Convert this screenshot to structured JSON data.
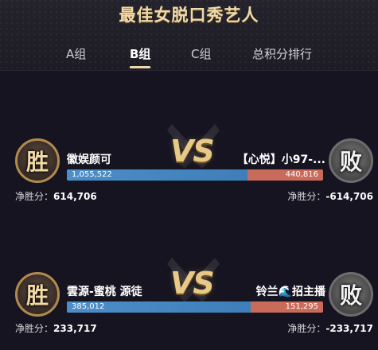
{
  "header": {
    "title": "最佳女脱口秀艺人",
    "tabs": [
      {
        "label": "A组",
        "active": false
      },
      {
        "label": "B组",
        "active": true
      },
      {
        "label": "C组",
        "active": false
      },
      {
        "label": "总积分排行",
        "active": false
      }
    ]
  },
  "matches": [
    {
      "vs": "VS",
      "left": {
        "result_badge": "胜",
        "name": "徽娱颜可",
        "votes": "1,055,522",
        "net_label": "净胜分：",
        "net_value": "614,706"
      },
      "right": {
        "result_badge": "败",
        "name": "【心悦】小97-...",
        "votes": "440,816",
        "net_label": "净胜分：",
        "net_value": "-614,706"
      },
      "left_share": 0.7054
    },
    {
      "vs": "VS",
      "left": {
        "result_badge": "胜",
        "name": "雲源-蜜桃 源徒",
        "votes": "385,012",
        "net_label": "净胜分：",
        "net_value": "233,717"
      },
      "right": {
        "result_badge": "败",
        "name": "铃兰🌊招主播",
        "votes": "151,295",
        "net_label": "净胜分：",
        "net_value": "-233,717"
      },
      "left_share": 0.7179
    }
  ],
  "colors": {
    "accent_gold": "#f0d9a8",
    "bar_blue": "#4e8ec8",
    "bar_red": "#c86b5a",
    "background": "#151420"
  }
}
